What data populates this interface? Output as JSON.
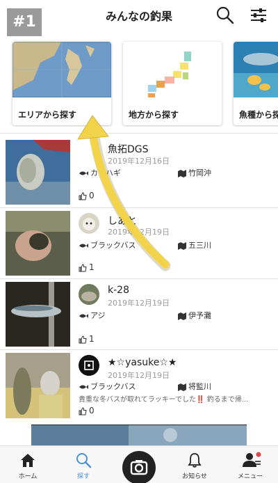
{
  "badge": "#1",
  "header": {
    "title": "みんなの釣果",
    "search_icon": "search-icon",
    "filter_icon": "sliders-icon"
  },
  "categories": [
    {
      "label": "エリアから探す",
      "icon": "map-photo"
    },
    {
      "label": "地方から探す",
      "icon": "japan-region-map"
    },
    {
      "label": "魚種から探す",
      "icon": "fish-photo"
    }
  ],
  "posts": [
    {
      "user": "魚拓DGS",
      "date": "2019年12月16日",
      "fish": "カワハギ",
      "place": "竹岡沖",
      "likes": "0",
      "desc": ""
    },
    {
      "user": "しあと",
      "date": "2019年12月19日",
      "fish": "ブラックバス",
      "place": "五三川",
      "likes": "1",
      "desc": ""
    },
    {
      "user": "k-28",
      "date": "2019年12月19日",
      "fish": "アジ",
      "place": "伊予灘",
      "likes": "1",
      "desc": ""
    },
    {
      "user": "★☆yasuke☆★",
      "date": "2019年12月19日",
      "fish": "ブラックバス",
      "place": "将監川",
      "likes": "0",
      "desc": "貴重な冬バスが取れてラッキーでした‼️ 釣るまで帰..."
    }
  ],
  "tabs": [
    {
      "label": "ホーム"
    },
    {
      "label": "探す"
    },
    {
      "label": ""
    },
    {
      "label": "お知らせ"
    },
    {
      "label": "メニュー"
    }
  ],
  "colors": {
    "accent": "#4a90d9",
    "arrow": "#f3d34a",
    "badge": "#9a9a9a"
  }
}
